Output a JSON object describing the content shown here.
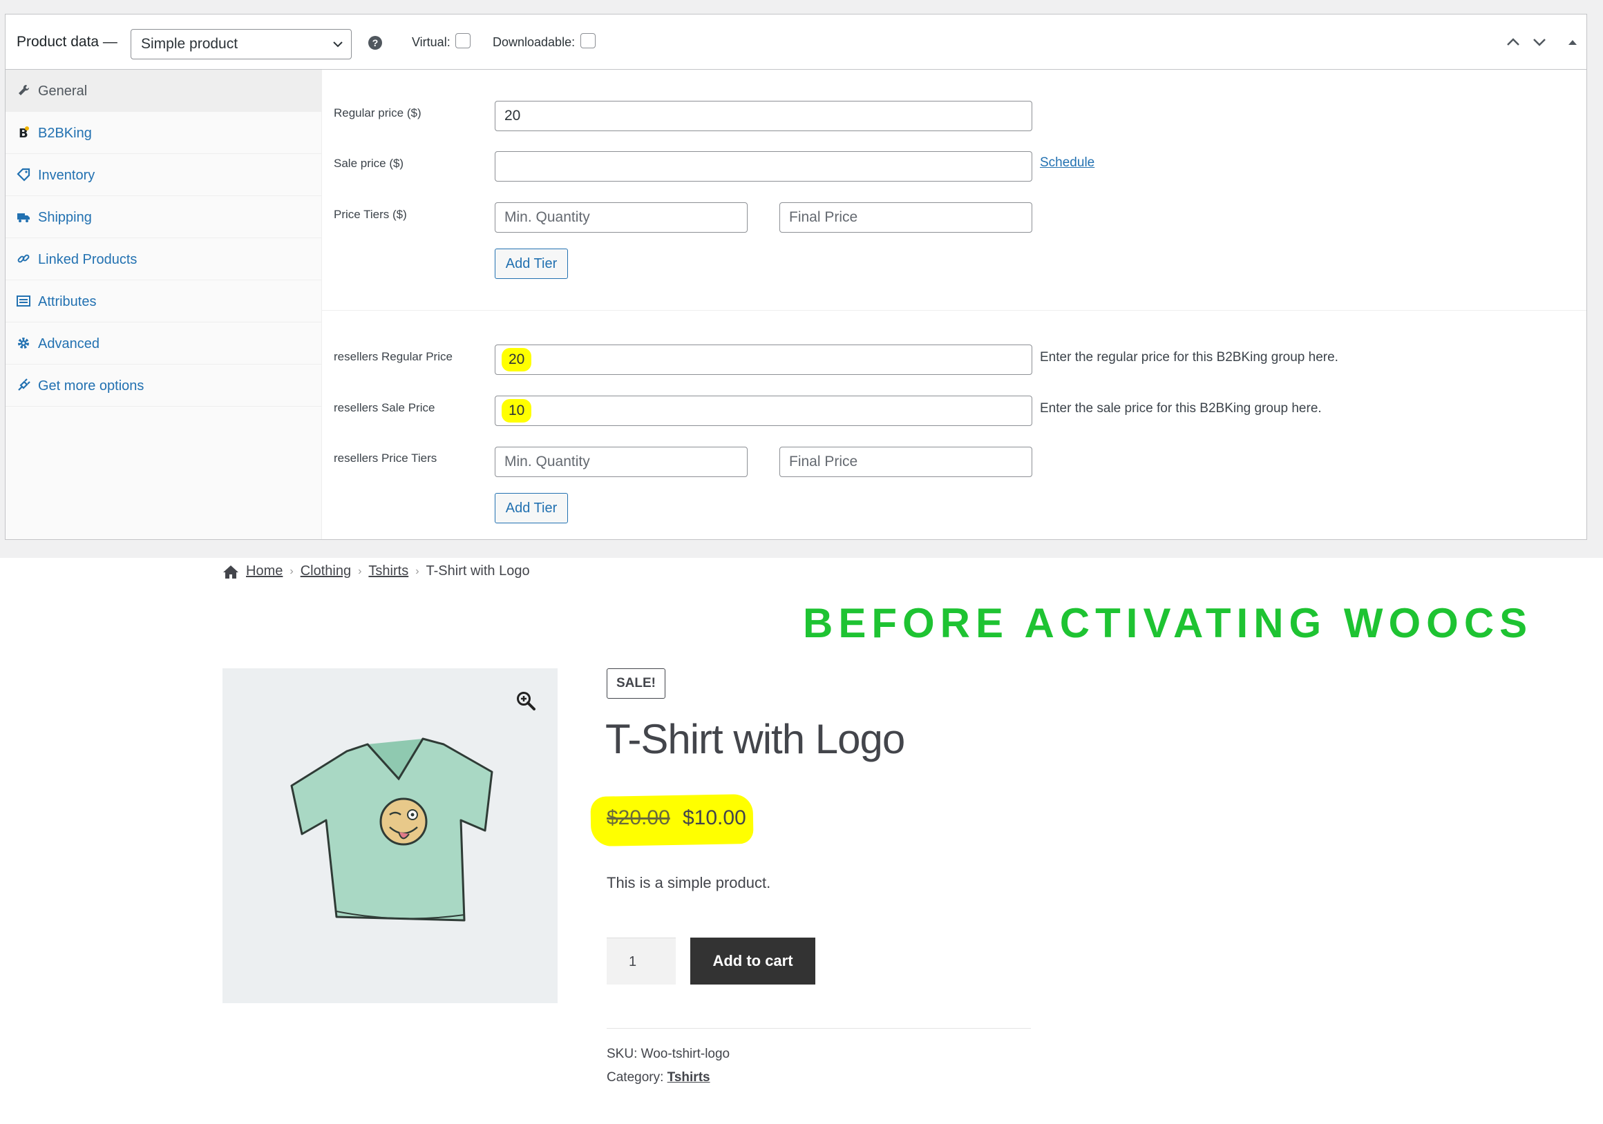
{
  "admin": {
    "header": {
      "title": "Product data —",
      "product_type": "Simple product",
      "help_symbol": "?",
      "virtual_label": "Virtual:",
      "downloadable_label": "Downloadable:"
    },
    "tabs": [
      {
        "label": "General",
        "icon": "wrench-icon",
        "active": true
      },
      {
        "label": "B2BKing",
        "icon": "b2bking-logo-icon",
        "active": false
      },
      {
        "label": "Inventory",
        "icon": "tag-icon",
        "active": false
      },
      {
        "label": "Shipping",
        "icon": "truck-icon",
        "active": false
      },
      {
        "label": "Linked Products",
        "icon": "link-icon",
        "active": false
      },
      {
        "label": "Attributes",
        "icon": "list-icon",
        "active": false
      },
      {
        "label": "Advanced",
        "icon": "gear-icon",
        "active": false
      },
      {
        "label": "Get more options",
        "icon": "plugin-icon",
        "active": false
      }
    ],
    "general": {
      "regular_price_label": "Regular price ($)",
      "regular_price_value": "20",
      "sale_price_label": "Sale price ($)",
      "sale_price_value": "",
      "schedule_link": "Schedule",
      "price_tiers_label": "Price Tiers ($)",
      "min_qty_placeholder": "Min. Quantity",
      "final_price_placeholder": "Final Price",
      "add_tier_label": "Add Tier"
    },
    "group": {
      "regular_label": "resellers Regular Price",
      "regular_value": "20",
      "regular_desc": "Enter the regular price for this B2BKing group here.",
      "sale_label": "resellers Sale Price",
      "sale_value": "10",
      "sale_desc": "Enter the sale price for this B2BKing group here.",
      "tiers_label": "resellers Price Tiers",
      "min_qty_placeholder": "Min. Quantity",
      "final_price_placeholder": "Final Price",
      "add_tier_label": "Add Tier"
    }
  },
  "store": {
    "breadcrumb": [
      "Home",
      "Clothing",
      "Tshirts",
      "T-Shirt with Logo"
    ],
    "annotation": "BEFORE ACTIVATING WOOCS",
    "sale_badge": "Sale!",
    "title": "T-Shirt with Logo",
    "regular_price": "$20.00",
    "sale_price": "$10.00",
    "short_description": "This is a simple product.",
    "quantity": "1",
    "add_to_cart": "Add to cart",
    "sku_label": "SKU:",
    "sku_value": "Woo-tshirt-logo",
    "category_label": "Category:",
    "category_value": "Tshirts"
  },
  "colors": {
    "accent": "#2271b1",
    "highlight": "#ffff00",
    "annotation": "#1ec332",
    "button_dark": "#333333"
  }
}
